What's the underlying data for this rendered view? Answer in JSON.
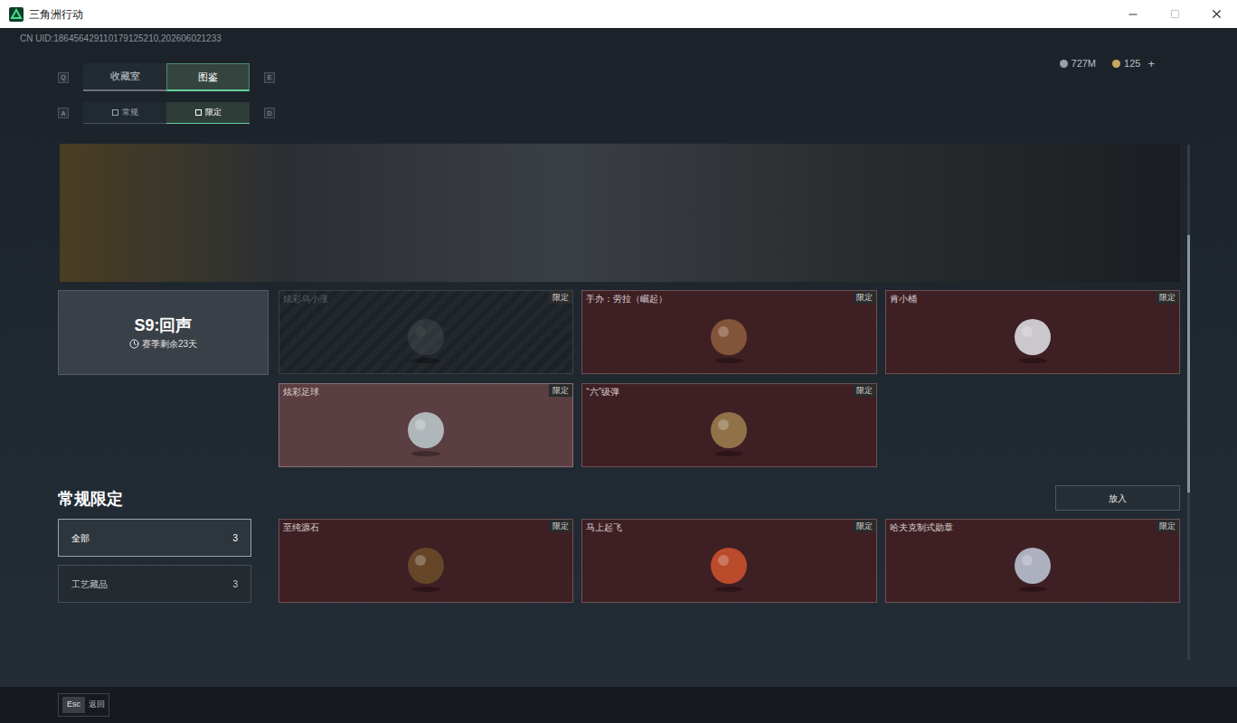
{
  "window": {
    "title": "三角洲行动"
  },
  "uid": "CN UID:186456429110179125210,202606021233",
  "currencies": [
    {
      "value": "727M",
      "action": ""
    },
    {
      "value": "125",
      "action": "+"
    }
  ],
  "main_tabs": {
    "prev_key": "Q",
    "next_key": "E",
    "items": [
      {
        "label": "收藏室",
        "selected": false
      },
      {
        "label": "图鉴",
        "selected": true
      }
    ]
  },
  "sub_tabs": {
    "prev_key": "A",
    "next_key": "D",
    "items": [
      {
        "label": "常规",
        "selected": false
      },
      {
        "label": "限定",
        "selected": true
      }
    ]
  },
  "season": {
    "title": "S9:回声",
    "remaining": "赛季剩余23天",
    "items": [
      {
        "name": "炫彩乌小涨",
        "badge": "限定",
        "locked": true,
        "selected": false
      },
      {
        "name": "手办：劳拉（崛起）",
        "badge": "限定",
        "locked": false,
        "selected": false
      },
      {
        "name": "肯小桶",
        "badge": "限定",
        "locked": false,
        "selected": false
      },
      {
        "name": "炫彩足球",
        "badge": "限定",
        "locked": false,
        "selected": true
      },
      {
        "name": "“六”级弹",
        "badge": "限定",
        "locked": false,
        "selected": false
      }
    ]
  },
  "regular": {
    "title": "常规限定",
    "button": "放入",
    "filters": [
      {
        "label": "全部",
        "count": "3",
        "selected": true
      },
      {
        "label": "工艺藏品",
        "count": "3",
        "selected": false
      }
    ],
    "items": [
      {
        "name": "至纯源石",
        "badge": "限定",
        "locked": false,
        "selected": false
      },
      {
        "name": "马上起飞",
        "badge": "限定",
        "locked": false,
        "selected": false
      },
      {
        "name": "哈夫克制式勋章",
        "badge": "限定",
        "locked": false,
        "selected": false
      }
    ]
  },
  "footer": {
    "key": "Esc",
    "label": "返回"
  }
}
